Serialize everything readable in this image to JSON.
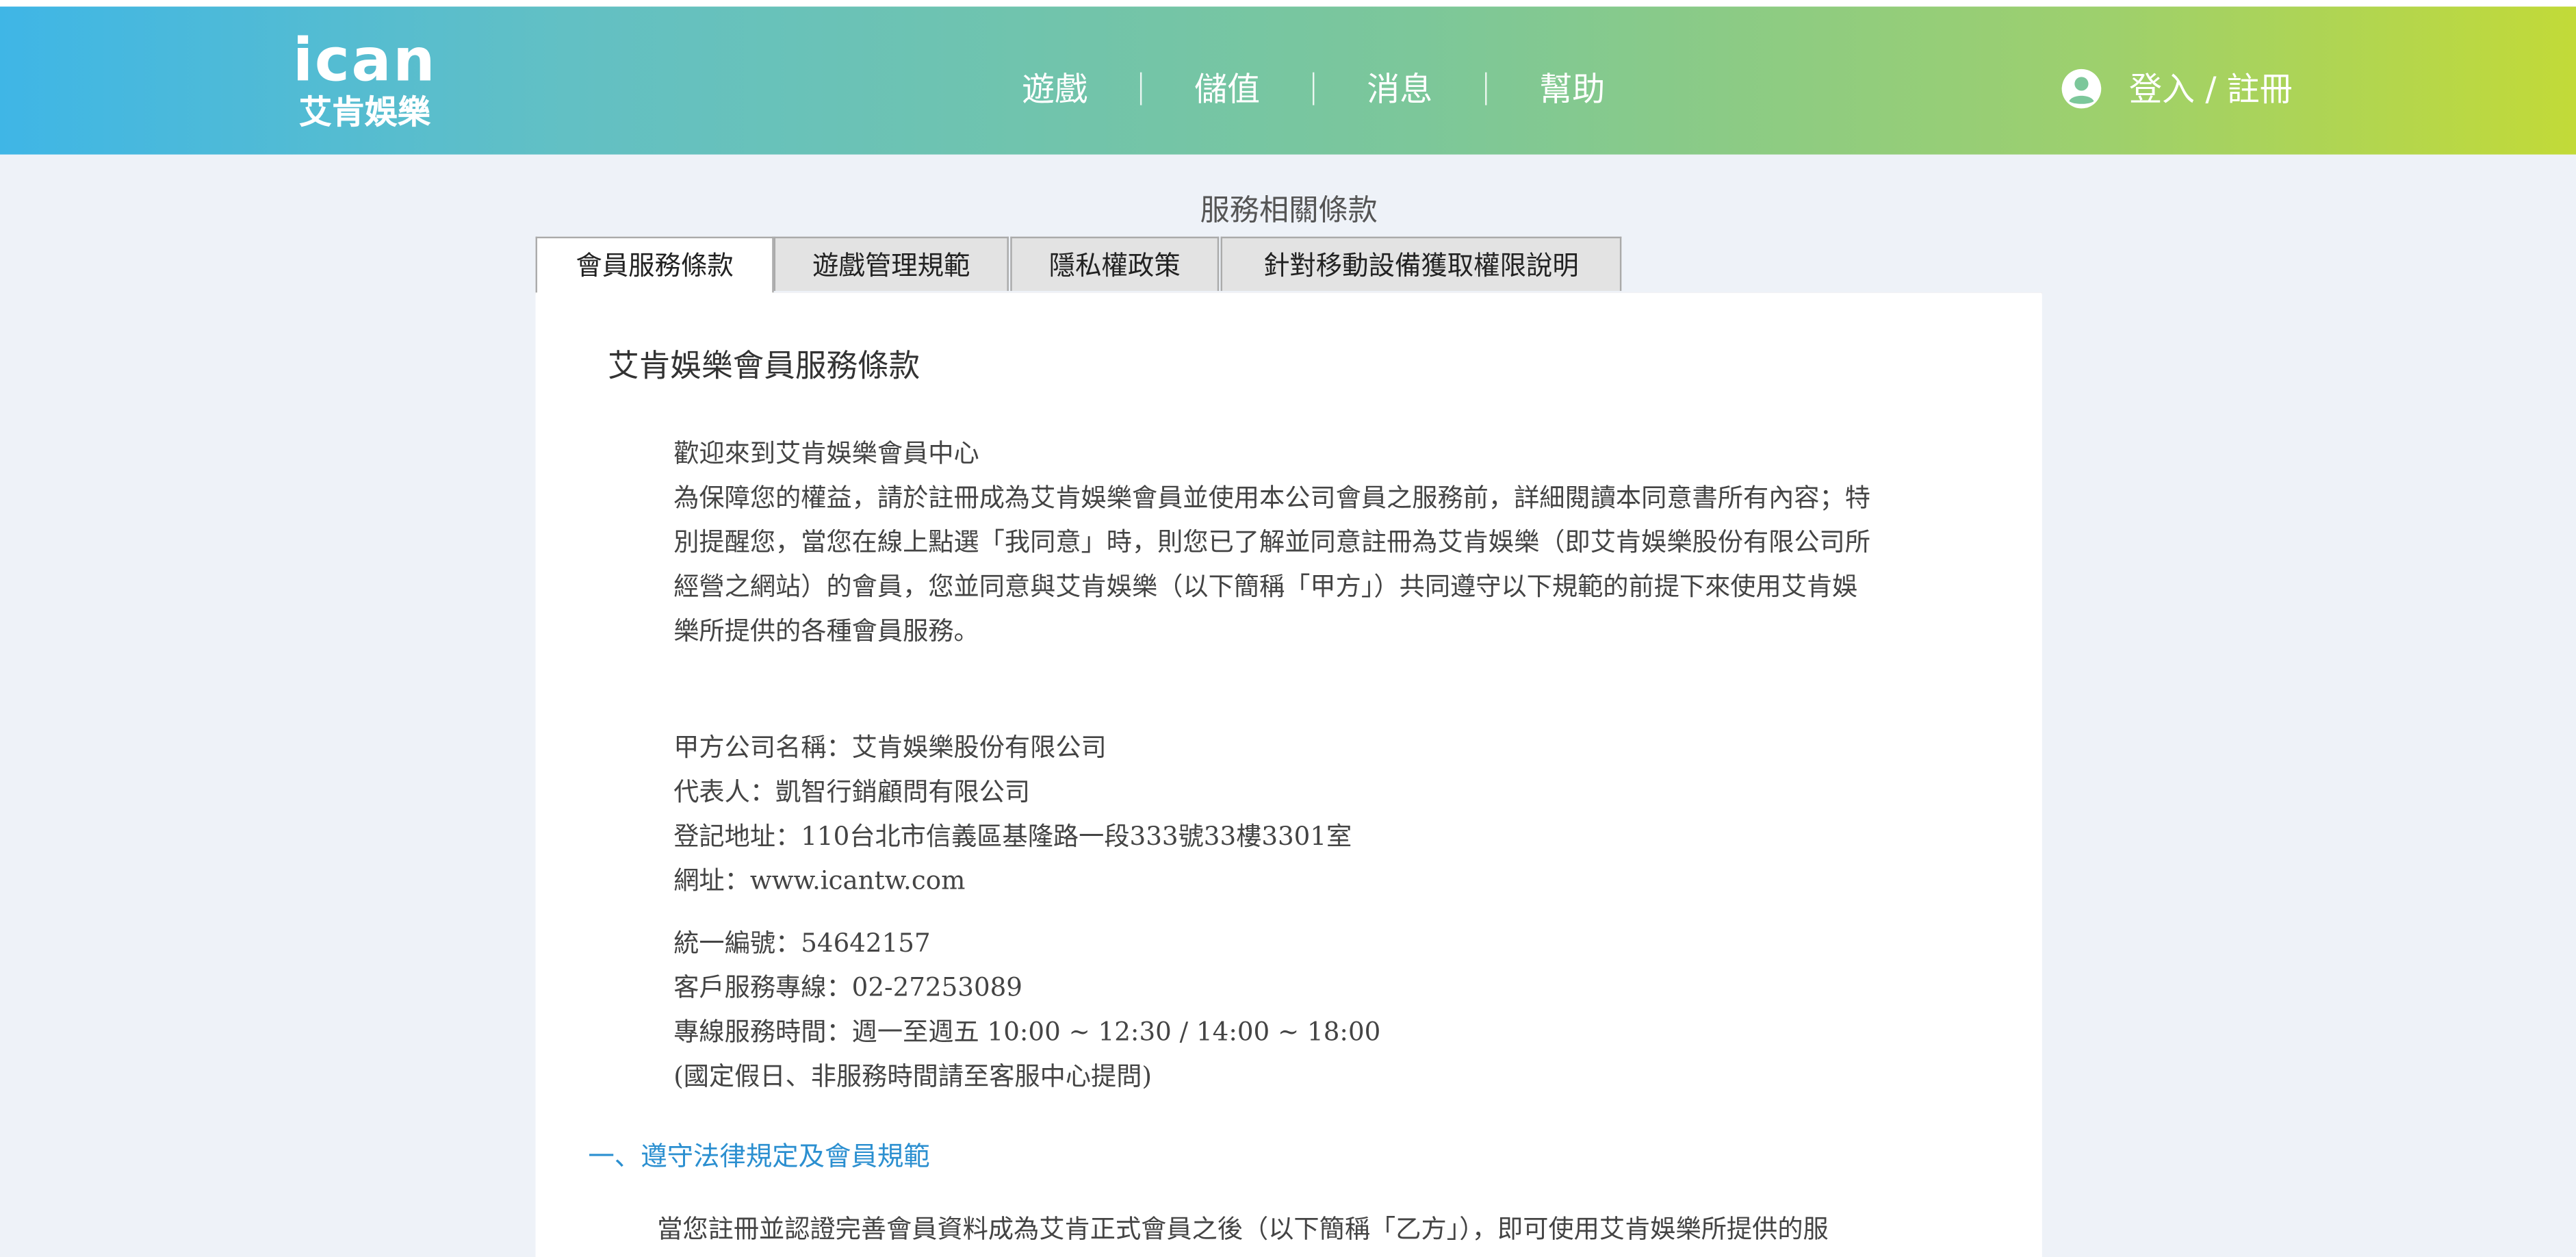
{
  "header": {
    "logo_en": "ICAN",
    "logo_cn": "艾肯娛樂",
    "nav": [
      "遊戲",
      "儲值",
      "消息",
      "幫助"
    ],
    "login": "登入 / 註冊",
    "icons": {
      "user": "user-circle-icon"
    },
    "gradient": [
      "#3fb6e6",
      "#c2da38"
    ]
  },
  "page": {
    "title": "服務相關條款",
    "tabs": [
      "會員服務條款",
      "遊戲管理規範",
      "隱私權政策",
      "針對移動設備獲取權限說明"
    ],
    "active_tab": "會員服務條款"
  },
  "doc": {
    "title": "艾肯娛樂會員服務條款",
    "intro": [
      "歡迎來到艾肯娛樂會員中心",
      "為保障您的權益，請於註冊成為艾肯娛樂會員並使用本公司會員之服務前，詳細閱讀本同意書所有內容；特",
      "別提醒您，當您在線上點選「我同意」時，則您已了解並同意註冊為艾肯娛樂（即艾肯娛樂股份有限公司所",
      "經營之網站）的會員，您並同意與艾肯娛樂（以下簡稱「甲方」）共同遵守以下規範的前提下來使用艾肯娛",
      "樂所提供的各種會員服務。"
    ],
    "company": [
      "甲方公司名稱：艾肯娛樂股份有限公司",
      "代表人：凱智行銷顧問有限公司",
      "登記地址：110台北市信義區基隆路一段333號33樓3301室",
      "網址：www.icantw.com"
    ],
    "contact": [
      "統一編號：54642157",
      "客戶服務專線：02-27253089",
      "專線服務時間：週一至週五 10:00 ~ 12:30 / 14:00 ~ 18:00",
      "(國定假日、非服務時間請至客服中心提問)"
    ],
    "section1_title": "一、遵守法律規定及會員規範",
    "section1_text": "當您註冊並認證完善會員資料成為艾肯正式會員之後（以下簡稱「乙方」），即可使用艾肯娛樂所提供的服",
    "section_color": "#2b8fd0"
  }
}
